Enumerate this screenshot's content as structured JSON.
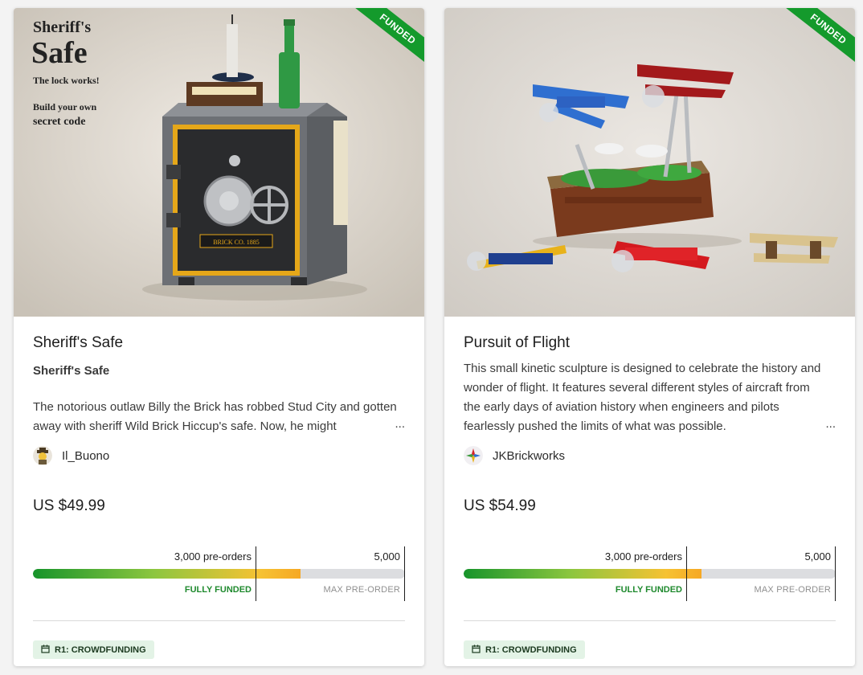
{
  "cards": [
    {
      "ribbon": "FUNDED",
      "title": "Sheriff's Safe",
      "subtitle": "Sheriff's Safe",
      "description": "The notorious outlaw Billy the Brick has robbed Stud City and gotten away with sheriff Wild Brick Hiccup's safe. Now, he might",
      "ellipsis": "...",
      "creator": "Il_Buono",
      "price": "US $49.99",
      "image_text": {
        "line1": "Sheriff's",
        "line2": "Safe",
        "line3": "The lock works!",
        "line4": "Build your own",
        "line5": "secret code",
        "plaque": "BRICK CO. 1885"
      },
      "progress": {
        "funded_marker_label": "3,000 pre-orders",
        "funded_status": "FULLY FUNDED",
        "max_label": "5,000",
        "max_status": "MAX PRE-ORDER",
        "fill_percent": 72
      },
      "badge": "R1: CROWDFUNDING"
    },
    {
      "ribbon": "FUNDED",
      "title": "Pursuit of Flight",
      "subtitle": "",
      "description": "This small kinetic sculpture is designed to celebrate the history and wonder of flight. It features several different styles of aircraft from the early days of aviation history when engineers and pilots fearlessly pushed the limits of what was possible.",
      "ellipsis": "...",
      "creator": "JKBrickworks",
      "price": "US $54.99",
      "progress": {
        "funded_marker_label": "3,000 pre-orders",
        "funded_status": "FULLY FUNDED",
        "max_label": "5,000",
        "max_status": "MAX PRE-ORDER",
        "fill_percent": 64
      },
      "badge": "R1: CROWDFUNDING"
    }
  ],
  "colors": {
    "funded_green": "#149a2c",
    "badge_bg": "#e3f3e6",
    "track": "#dcdde0"
  },
  "icons": [
    "calendar-icon",
    "funded-ribbon"
  ]
}
